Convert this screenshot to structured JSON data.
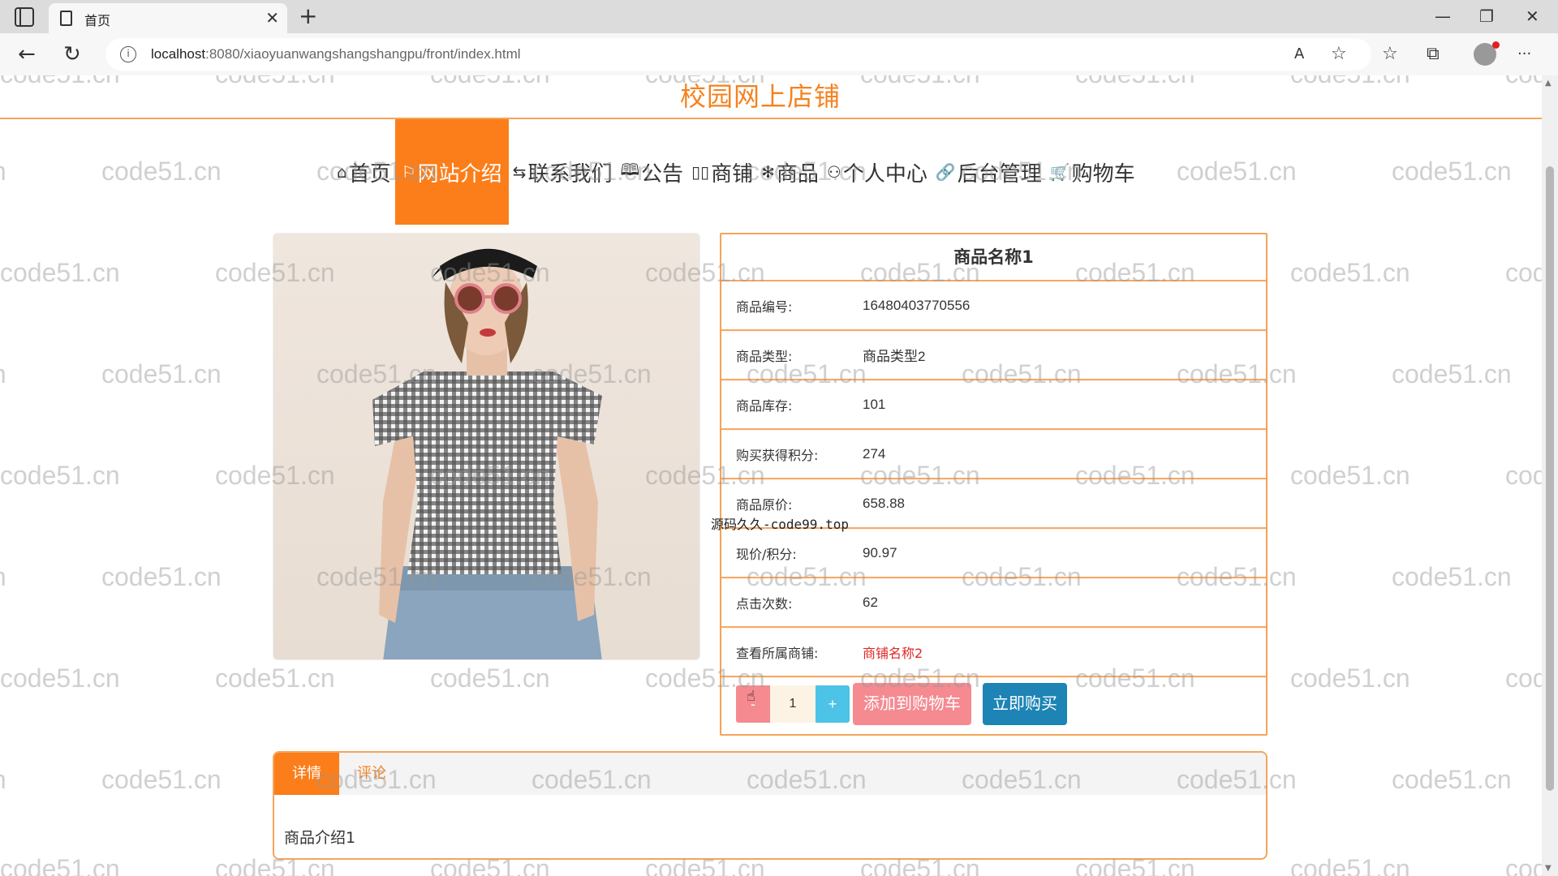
{
  "browser": {
    "tab_title": "首页",
    "tab_close": "✕",
    "new_tab": "+",
    "url_host": "localhost",
    "url_rest": ":8080/xiaoyuanwangshangshangpu/front/index.html",
    "minimize": "—",
    "restore": "❐",
    "close": "✕",
    "back": "←",
    "reload": "↻",
    "read_aloud": "A",
    "favorite_add": "☆",
    "favorites": "☆",
    "collections": "⧉",
    "more": "···"
  },
  "site": {
    "title": "校园网上店铺"
  },
  "nav": [
    {
      "icon": "⌂",
      "label": "首页"
    },
    {
      "icon": "⚐",
      "label": "网站介绍"
    },
    {
      "icon": "⇆",
      "label": "联系我们"
    },
    {
      "icon": "🕮",
      "label": "公告"
    },
    {
      "icon": "▯▯",
      "label": "商铺"
    },
    {
      "icon": "✻",
      "label": "商品"
    },
    {
      "icon": "⚇",
      "label": "个人中心"
    },
    {
      "icon": "🔗",
      "label": "后台管理"
    },
    {
      "icon": "🛒",
      "label": "购物车"
    }
  ],
  "product": {
    "name": "商品名称1",
    "rows": [
      {
        "label": "商品编号:",
        "value": "16480403770556"
      },
      {
        "label": "商品类型:",
        "value": "商品类型2"
      },
      {
        "label": "商品库存:",
        "value": "101"
      },
      {
        "label": "购买获得积分:",
        "value": "274"
      },
      {
        "label": "商品原价:",
        "value": "658.88"
      },
      {
        "label": "现价/积分:",
        "value": "90.97"
      },
      {
        "label": "点击次数:",
        "value": "62"
      },
      {
        "label": "查看所属商铺:",
        "value": "商铺名称2"
      }
    ],
    "qty_minus": "-",
    "qty_value": "1",
    "qty_plus": "+",
    "add_to_cart": "添加到购物车",
    "buy_now": "立即购买"
  },
  "tabs": {
    "items": [
      "详情",
      "评论"
    ],
    "content": "商品介绍1"
  },
  "overlay": {
    "watermark": "code51.cn",
    "stamp": "源码久久-code99.top"
  },
  "colors": {
    "accent": "#fb7e1a",
    "title": "#f5821f",
    "border": "#f5a45a",
    "link": "#e02626",
    "cart_button": "#f58a91",
    "buy_button": "#1d84b5",
    "plus_button": "#4dc3e8"
  }
}
